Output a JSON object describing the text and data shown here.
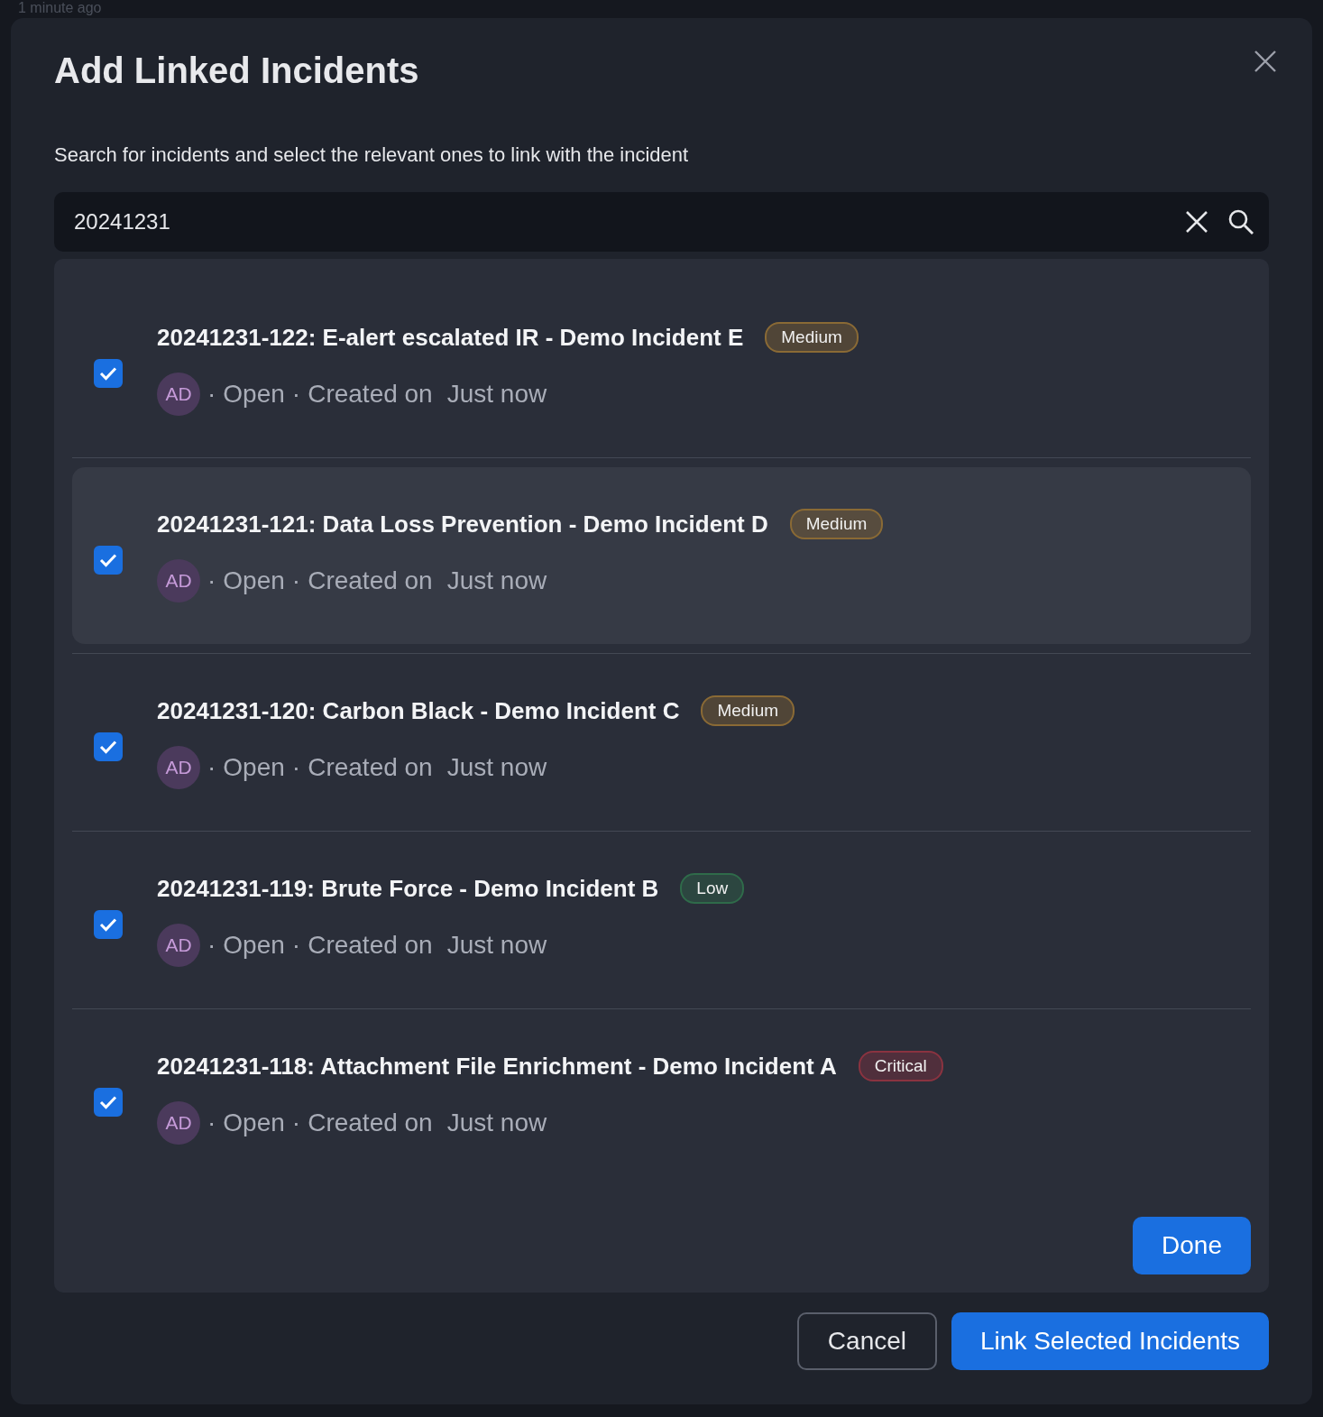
{
  "background": {
    "timestamp": "1 minute ago"
  },
  "dialog": {
    "title": "Add Linked Incidents",
    "description": "Search for incidents and select the relevant ones to link with the incident",
    "search": {
      "value": "20241231"
    },
    "results": [
      {
        "title": "20241231-122: E-alert escalated IR - Demo Incident E",
        "severity": "Medium",
        "color": "#8a6a35",
        "checked": true,
        "highlighted": false,
        "initials": "AD",
        "separator": "·",
        "status": "Open",
        "created_label": "Created on",
        "created": "Just now"
      },
      {
        "title": "20241231-121: Data Loss Prevention - Demo Incident D",
        "severity": "Medium",
        "color": "#8a6a35",
        "checked": true,
        "highlighted": true,
        "initials": "AD",
        "separator": "·",
        "status": "Open",
        "created_label": "Created on",
        "created": "Just now"
      },
      {
        "title": "20241231-120: Carbon Black - Demo Incident C",
        "severity": "Medium",
        "color": "#8a6a35",
        "checked": true,
        "highlighted": false,
        "initials": "AD",
        "separator": "·",
        "status": "Open",
        "created_label": "Created on",
        "created": "Just now"
      },
      {
        "title": "20241231-119: Brute Force - Demo Incident B",
        "severity": "Low",
        "color": "#2f6b4a",
        "checked": true,
        "highlighted": false,
        "initials": "AD",
        "separator": "·",
        "status": "Open",
        "created_label": "Created on",
        "created": "Just now"
      },
      {
        "title": "20241231-118: Attachment File Enrichment - Demo Incident A",
        "severity": "Critical",
        "color": "#8a3340",
        "checked": true,
        "highlighted": false,
        "initials": "AD",
        "separator": "·",
        "status": "Open",
        "created_label": "Created on",
        "created": "Just now"
      }
    ],
    "done_button": "Done",
    "buttons": [
      {
        "label": "Cancel",
        "kind": "secondary"
      },
      {
        "label": "Link Selected Incidents",
        "kind": "primary"
      }
    ]
  }
}
